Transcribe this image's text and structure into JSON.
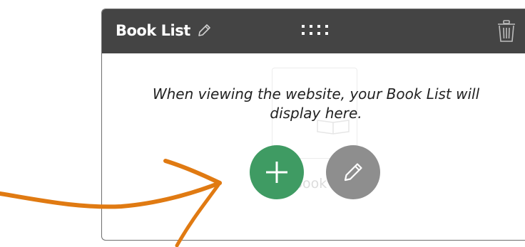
{
  "widget": {
    "title": "Book List",
    "message": "When viewing the website, your Book List will display here.",
    "placeholder_label": "Book L",
    "icons": {
      "edit_title": "pencil-icon",
      "drag": "drag-handle-icon",
      "delete": "trash-icon",
      "add": "plus-icon",
      "edit": "pencil-icon"
    }
  },
  "colors": {
    "header_bg": "#444444",
    "add_button": "#3f9b63",
    "edit_button": "#8e8e8e",
    "arrow": "#e07a12"
  }
}
